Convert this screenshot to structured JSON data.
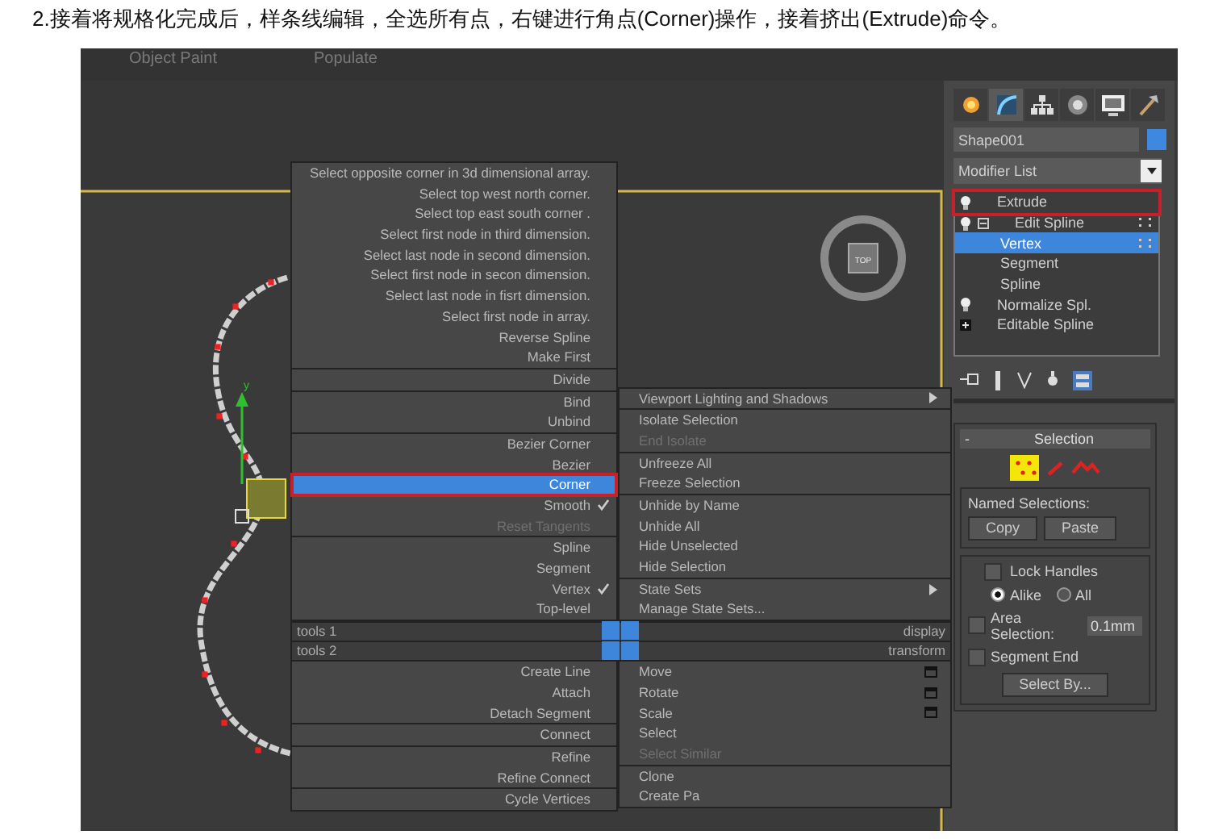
{
  "caption": "2.接着将规格化完成后，样条线编辑，全选所有点，右键进行角点(Corner)操作，接着挤出(Extrude)命令。",
  "toolbar": [
    "Object Paint",
    "Populate"
  ],
  "viewport": {
    "viewcube_label": "TOP",
    "axis_label": "y"
  },
  "quad_menu": {
    "top_left": [
      [
        {
          "label": "Select opposite corner in 3d dimensional array.",
          "selected": false,
          "checked": false,
          "disabled": false
        },
        {
          "label": "Select top west north corner.",
          "selected": false,
          "checked": false,
          "disabled": false
        },
        {
          "label": "Select top east south corner .",
          "selected": false,
          "checked": false,
          "disabled": false
        },
        {
          "label": "Select first node in third dimension.",
          "selected": false,
          "checked": false,
          "disabled": false
        },
        {
          "label": "Select last node in second dimension.",
          "selected": false,
          "checked": false,
          "disabled": false
        },
        {
          "label": "Select first node in secon dimension.",
          "selected": false,
          "checked": false,
          "disabled": false
        },
        {
          "label": "Select last node in fisrt dimension.",
          "selected": false,
          "checked": false,
          "disabled": false
        },
        {
          "label": "Select first node in array.",
          "selected": false,
          "checked": false,
          "disabled": false
        },
        {
          "label": "Reverse Spline",
          "selected": false,
          "checked": false,
          "disabled": false
        },
        {
          "label": "Make First",
          "selected": false,
          "checked": false,
          "disabled": false
        }
      ],
      [
        {
          "label": "Divide",
          "selected": false,
          "checked": false,
          "disabled": false
        }
      ],
      [
        {
          "label": "Bind",
          "selected": false,
          "checked": false,
          "disabled": false
        },
        {
          "label": "Unbind",
          "selected": false,
          "checked": false,
          "disabled": false
        }
      ],
      [
        {
          "label": "Bezier Corner",
          "selected": false,
          "checked": false,
          "disabled": false
        },
        {
          "label": "Bezier",
          "selected": false,
          "checked": false,
          "disabled": false
        },
        {
          "label": "Corner",
          "selected": true,
          "checked": false,
          "disabled": false,
          "highlighted": true
        },
        {
          "label": "Smooth",
          "selected": false,
          "checked": true,
          "disabled": false
        },
        {
          "label": "Reset Tangents",
          "selected": false,
          "checked": false,
          "disabled": true
        }
      ],
      [
        {
          "label": "Spline",
          "selected": false,
          "checked": false,
          "disabled": false
        },
        {
          "label": "Segment",
          "selected": false,
          "checked": false,
          "disabled": false
        },
        {
          "label": "Vertex",
          "selected": false,
          "checked": true,
          "disabled": false
        },
        {
          "label": "Top-level",
          "selected": false,
          "checked": false,
          "disabled": false
        }
      ]
    ],
    "top_right": [
      [
        {
          "label": "Viewport Lighting and Shadows",
          "disabled": false,
          "submenu": true
        }
      ],
      [
        {
          "label": "Isolate Selection",
          "disabled": false,
          "submenu": false
        },
        {
          "label": "End Isolate",
          "disabled": true,
          "submenu": false
        }
      ],
      [
        {
          "label": "Unfreeze All",
          "disabled": false,
          "submenu": false
        },
        {
          "label": "Freeze Selection",
          "disabled": false,
          "submenu": false
        }
      ],
      [
        {
          "label": "Unhide by Name",
          "disabled": false,
          "submenu": false
        },
        {
          "label": "Unhide All",
          "disabled": false,
          "submenu": false
        },
        {
          "label": "Hide Unselected",
          "disabled": false,
          "submenu": false
        },
        {
          "label": "Hide Selection",
          "disabled": false,
          "submenu": false
        }
      ],
      [
        {
          "label": "State Sets",
          "disabled": false,
          "submenu": true
        },
        {
          "label": "Manage State Sets...",
          "disabled": false,
          "submenu": false
        }
      ]
    ],
    "labels": [
      {
        "left": "tools 1",
        "right": "display"
      },
      {
        "left": "tools 2",
        "right": "transform"
      }
    ],
    "bottom_left": [
      [
        {
          "label": "Create Line",
          "disabled": false
        },
        {
          "label": "Attach",
          "disabled": false
        },
        {
          "label": "Detach Segment",
          "disabled": false
        }
      ],
      [
        {
          "label": "Connect",
          "disabled": false
        }
      ],
      [
        {
          "label": "Refine",
          "disabled": false
        },
        {
          "label": "Refine Connect",
          "disabled": false
        }
      ],
      [
        {
          "label": "Cycle Vertices",
          "disabled": false
        }
      ]
    ],
    "bottom_right": [
      [
        {
          "label": "Move",
          "disabled": false,
          "options": true
        },
        {
          "label": "Rotate",
          "disabled": false,
          "options": true
        },
        {
          "label": "Scale",
          "disabled": false,
          "options": true
        },
        {
          "label": "Select",
          "disabled": false,
          "options": false
        },
        {
          "label": "Select Similar",
          "disabled": true,
          "options": false
        }
      ],
      [
        {
          "label": "Clone",
          "disabled": false,
          "options": false
        },
        {
          "label": "Create Pa",
          "disabled": false,
          "options": false
        }
      ]
    ]
  },
  "command_panel": {
    "tabs": [
      {
        "kind": "create",
        "selected": false
      },
      {
        "kind": "modify",
        "selected": true
      },
      {
        "kind": "hierarchy",
        "selected": false
      },
      {
        "kind": "motion",
        "selected": false
      },
      {
        "kind": "display",
        "selected": false
      },
      {
        "kind": "utilities",
        "selected": false
      }
    ],
    "object_name": "Shape001",
    "modifier_list": "Modifier List",
    "stack": [
      {
        "label": "Extrude",
        "kind": "modifier",
        "selected": false,
        "highlighted": true
      },
      {
        "label": "Edit Spline",
        "kind": "modifier",
        "selected": false,
        "highlighted": false,
        "expanded": true,
        "children": [
          {
            "label": "Vertex",
            "selected": true
          },
          {
            "label": "Segment",
            "selected": false
          },
          {
            "label": "Spline",
            "selected": false
          }
        ]
      },
      {
        "label": "Normalize Spl.",
        "kind": "modifier",
        "selected": false,
        "highlighted": false
      },
      {
        "label": "Editable Spline",
        "kind": "base",
        "selected": false,
        "highlighted": false
      }
    ],
    "selection": {
      "collapse": "-",
      "title": "Selection",
      "subobjects": [
        {
          "kind": "vertex",
          "selected": true
        },
        {
          "kind": "segment",
          "selected": false
        },
        {
          "kind": "spline",
          "selected": false
        }
      ],
      "named_selections": {
        "title": "Named Selections:",
        "buttons": [
          "Copy",
          "Paste"
        ]
      },
      "lock_handles": {
        "label": "Lock Handles",
        "checked": false
      },
      "radios": [
        {
          "label": "Alike",
          "selected": true
        },
        {
          "label": "All",
          "selected": false
        }
      ],
      "area_selection": {
        "label": "Area Selection:",
        "checked": false,
        "value": "0.1mm"
      },
      "segment_end": {
        "label": "Segment End",
        "checked": false
      },
      "select_by": "Select By..."
    }
  }
}
